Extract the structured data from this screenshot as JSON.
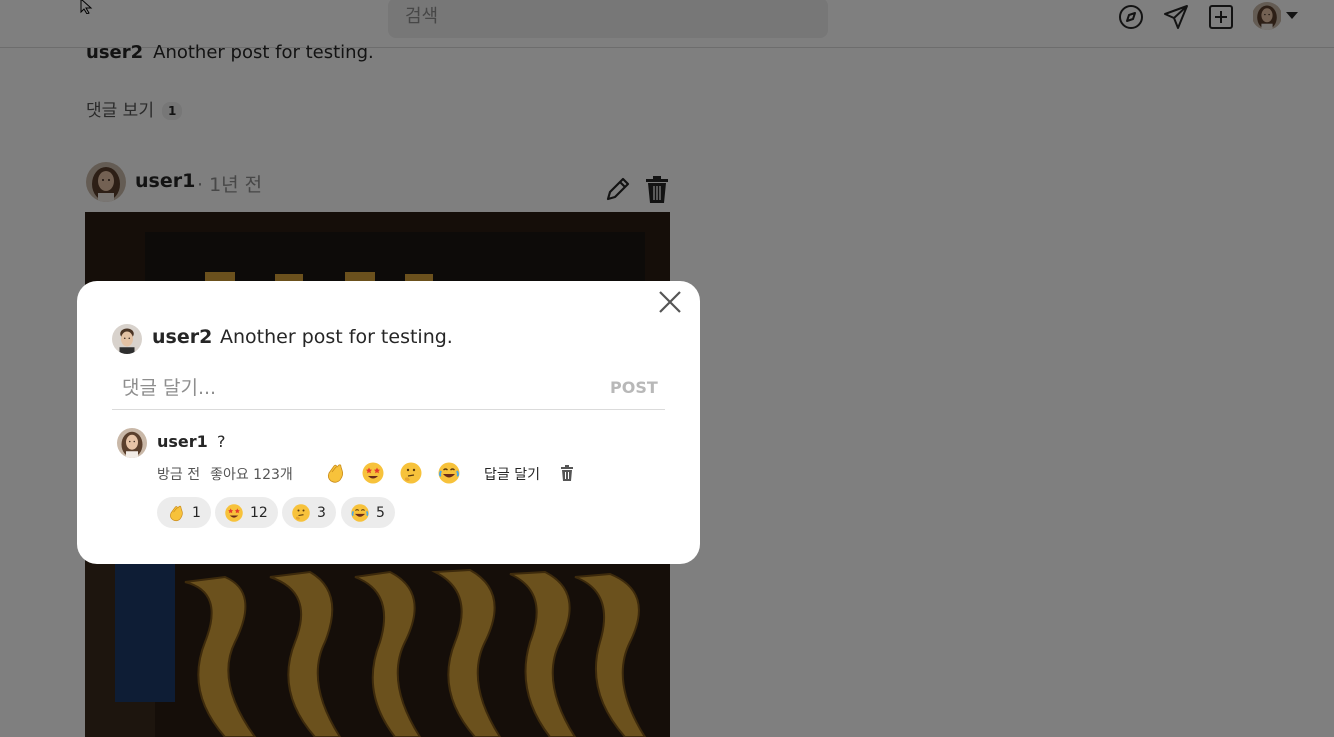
{
  "header": {
    "search_placeholder": "검색",
    "icons": [
      "compass-icon",
      "send-icon",
      "add-post-icon",
      "profile-avatar"
    ]
  },
  "feed": {
    "previous_post": {
      "user": "user2",
      "caption": "Another post for testing.",
      "view_comments_label": "댓글 보기",
      "comment_count": "1"
    },
    "post": {
      "user": "user1",
      "time": "· 1년 전"
    }
  },
  "modal": {
    "post_user": "user2",
    "post_caption": "Another post for testing.",
    "comment_placeholder": "댓글 달기...",
    "post_button_label": "POST",
    "comment": {
      "user": "user1",
      "text": "?",
      "time": "방금 전",
      "likes": "좋아요 123개",
      "reply_label": "답글 달기",
      "reaction_buttons": [
        "clapping-hands",
        "star-struck",
        "thinking-face",
        "joy-face"
      ],
      "reactions": [
        {
          "emoji": "clapping-hands",
          "count": "1"
        },
        {
          "emoji": "star-struck",
          "count": "12"
        },
        {
          "emoji": "thinking-face",
          "count": "3"
        },
        {
          "emoji": "joy-face",
          "count": "5"
        }
      ]
    }
  },
  "colors": {
    "overlay": "rgba(0,0,0,0.5)",
    "post_button_disabled": "#b8b8b8",
    "chip_background": "#ececec"
  }
}
